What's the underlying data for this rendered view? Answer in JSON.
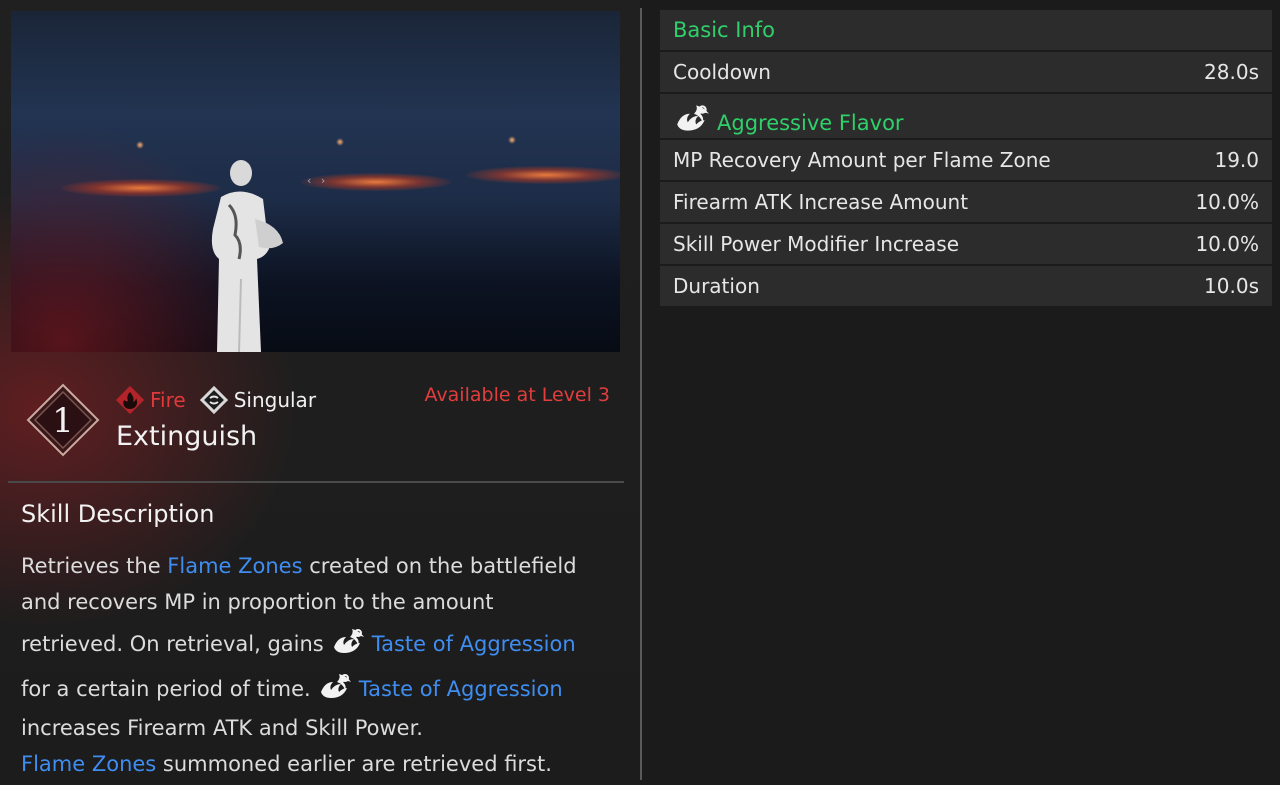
{
  "skill": {
    "number": "1",
    "element_tag": "Fire",
    "type_tag": "Singular",
    "name": "Extinguish",
    "availability": "Available at Level 3"
  },
  "description": {
    "title": "Skill Description",
    "l1_a": "Retrieves the ",
    "l1_link": "Flame Zones",
    "l1_b": " created on the battlefield",
    "l2": "and recovers MP in proportion to the amount",
    "l3_a": "retrieved. On retrieval, gains",
    "l3_link": "Taste of Aggression",
    "l4_a": "for a certain period of time.",
    "l4_link": "Taste of Aggression",
    "l5": "increases Firearm ATK and Skill Power.",
    "l6_link": "Flame Zones",
    "l6_b": " summoned earlier are retrieved first."
  },
  "stats": {
    "basic_header": "Basic Info",
    "cooldown_label": "Cooldown",
    "cooldown_value": "28.0s",
    "mod_header": "Aggressive Flavor",
    "rows": [
      {
        "label": "MP Recovery Amount per Flame Zone",
        "value": "19.0"
      },
      {
        "label": "Firearm ATK Increase Amount",
        "value": "10.0%"
      },
      {
        "label": "Skill Power Modifier Increase",
        "value": "10.0%"
      },
      {
        "label": "Duration",
        "value": "10.0s"
      }
    ]
  },
  "icons": {
    "element": "fire-element-icon",
    "type": "singular-type-icon",
    "aggression": "taste-of-aggression-icon"
  },
  "colors": {
    "accent_green": "#2fd06a",
    "link_blue": "#3f8df0",
    "fire_red": "#e0393b",
    "availability_red": "#e23d3d"
  }
}
